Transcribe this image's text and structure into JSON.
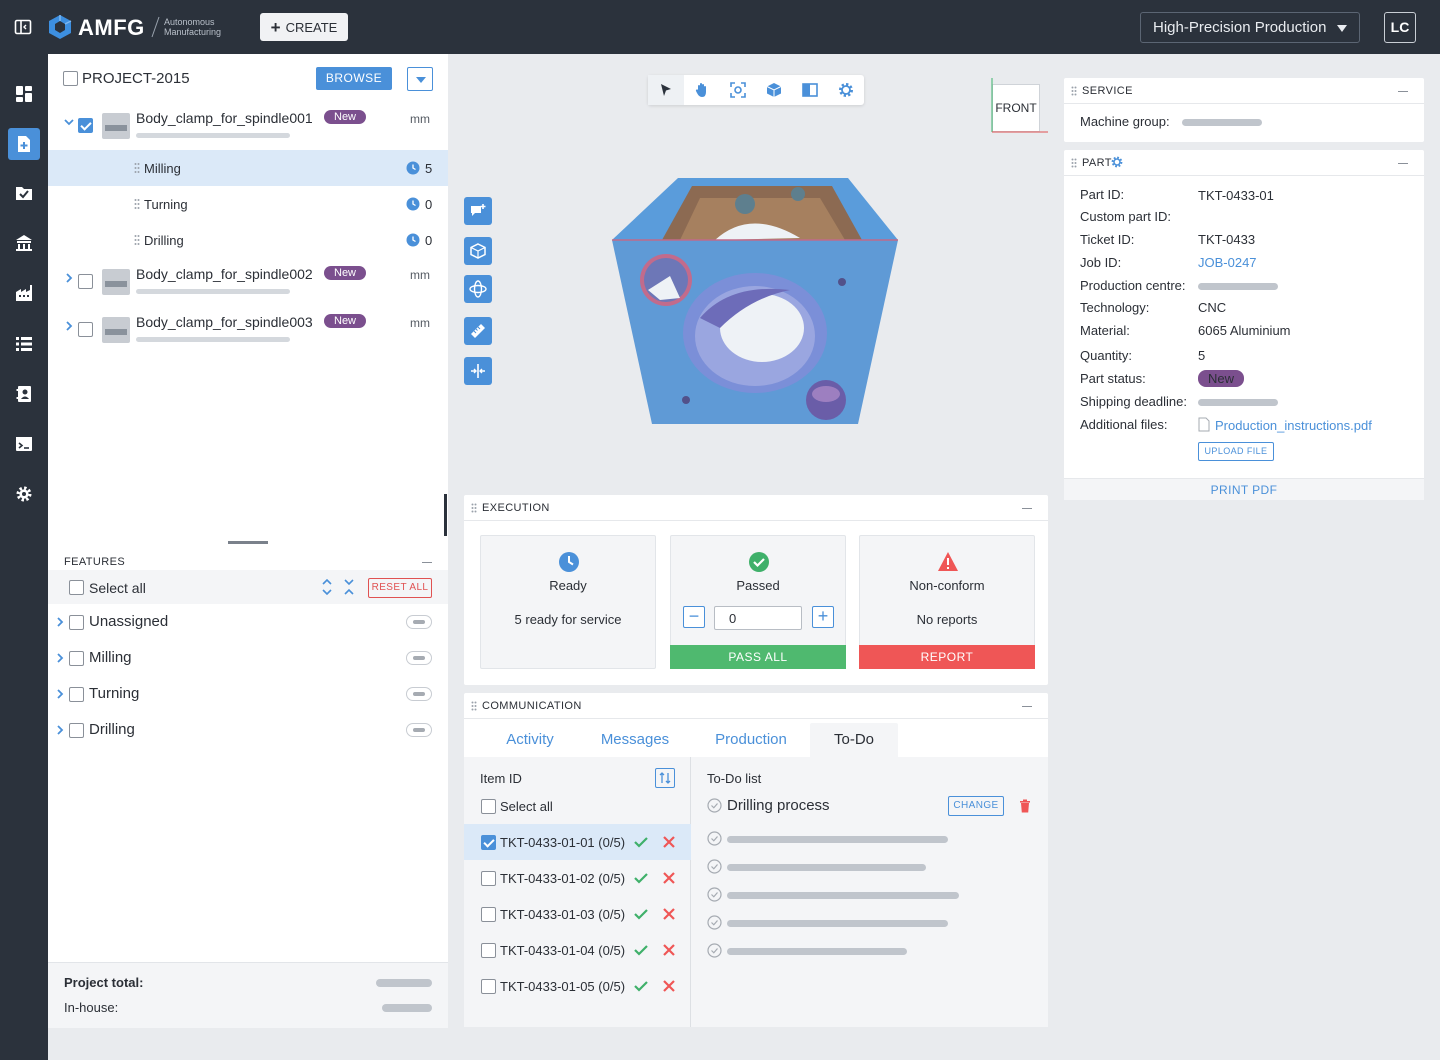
{
  "topbar": {
    "brand": "AMFG",
    "brand_sub_line1": "Autonomous",
    "brand_sub_line2": "Manufacturing",
    "create_label": "CREATE",
    "production_select": "High-Precision Production",
    "avatar_initials": "LC"
  },
  "rail": {
    "icons": [
      "dashboard-icon",
      "new-document-icon",
      "checklist-icon",
      "building-icon",
      "factory-icon",
      "list-icon",
      "contacts-icon",
      "terminal-icon",
      "settings-icon"
    ],
    "active_index": 1
  },
  "project": {
    "name": "PROJECT-2015",
    "browse_label": "BROWSE",
    "parts": [
      {
        "name": "Body_clamp_for_spindle001",
        "status": "New",
        "unit": "mm",
        "expanded": true,
        "checked": true
      },
      {
        "name": "Body_clamp_for_spindle002",
        "status": "New",
        "unit": "mm",
        "expanded": false,
        "checked": false
      },
      {
        "name": "Body_clamp_for_spindle003",
        "status": "New",
        "unit": "mm",
        "expanded": false,
        "checked": false
      }
    ],
    "operations": [
      {
        "label": "Milling",
        "count": "5"
      },
      {
        "label": "Turning",
        "count": "0"
      },
      {
        "label": "Drilling",
        "count": "0"
      }
    ]
  },
  "features": {
    "title": "FEATURES",
    "select_all": "Select all",
    "reset_label": "RESET ALL",
    "items": [
      "Unassigned",
      "Milling",
      "Turning",
      "Drilling"
    ]
  },
  "totals": {
    "project_total_label": "Project total:",
    "in_house_label": "In-house:"
  },
  "viewer": {
    "toolbar": [
      "pointer-icon",
      "hand-icon",
      "focus-icon",
      "cube-icon",
      "section-icon",
      "settings-icon"
    ],
    "orientation_label": "FRONT",
    "side_tools": [
      "add-comment-icon",
      "box-icon",
      "orbit-icon",
      "ruler-icon",
      "split-icon"
    ]
  },
  "execution": {
    "title": "EXECUTION",
    "ready_title": "Ready",
    "ready_sub": "5 ready for service",
    "passed_title": "Passed",
    "passed_value": "0",
    "pass_all_label": "PASS ALL",
    "nonconform_title": "Non-conform",
    "nonconform_sub": "No reports",
    "report_label": "REPORT"
  },
  "communication": {
    "title": "COMMUNICATION",
    "tabs": [
      "Activity",
      "Messages",
      "Production",
      "To-Do"
    ],
    "active_tab": "To-Do",
    "item_id_header": "Item ID",
    "select_all": "Select all",
    "items": [
      {
        "id": "TKT-0433-01-01",
        "progress": "(0/5)",
        "checked": true
      },
      {
        "id": "TKT-0433-01-02",
        "progress": "(0/5)",
        "checked": false
      },
      {
        "id": "TKT-0433-01-03",
        "progress": "(0/5)",
        "checked": false
      },
      {
        "id": "TKT-0433-01-04",
        "progress": "(0/5)",
        "checked": false
      },
      {
        "id": "TKT-0433-01-05",
        "progress": "(0/5)",
        "checked": false
      }
    ],
    "todo_header": "To-Do list",
    "todo_title": "Drilling process",
    "change_label": "CHANGE"
  },
  "service": {
    "title": "SERVICE",
    "machine_group_label": "Machine group:"
  },
  "part": {
    "title": "PART",
    "fields": {
      "part_id_label": "Part ID:",
      "part_id": "TKT-0433-01",
      "custom_part_id_label": "Custom part ID:",
      "ticket_id_label": "Ticket ID:",
      "ticket_id": "TKT-0433",
      "job_id_label": "Job ID:",
      "job_id": "JOB-0247",
      "production_centre_label": "Production centre:",
      "technology_label": "Technology:",
      "technology": "CNC",
      "material_label": "Material:",
      "material": "6065 Aluminium",
      "quantity_label": "Quantity:",
      "quantity": "5",
      "part_status_label": "Part status:",
      "part_status": "New",
      "shipping_deadline_label": "Shipping deadline:",
      "additional_files_label": "Additional files:",
      "file_name": "Production_instructions.pdf"
    },
    "upload_label": "UPLOAD FILE",
    "print_label": "PRINT PDF"
  },
  "colors": {
    "accent": "#4a90d9",
    "dark": "#2b323c",
    "success": "#4fb96f",
    "danger": "#ef5656",
    "badge": "#7b4f8e"
  }
}
